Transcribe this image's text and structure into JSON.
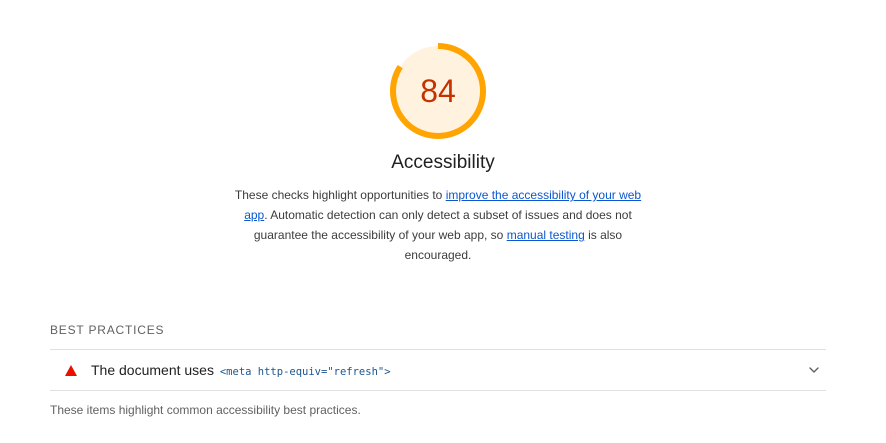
{
  "category": {
    "score": "84",
    "score_fraction": 0.84,
    "title": "Accessibility",
    "description": {
      "part1": "These checks highlight opportunities to ",
      "link1": "improve the accessibility of your web app",
      "part2": ". Automatic detection can only detect a subset of issues and does not guarantee the accessibility of your web app, so ",
      "link2": "manual testing",
      "part3": " is also encouraged."
    },
    "colors": {
      "gauge_arc": "#ffa400",
      "gauge_fill": "#fff3e0",
      "score_text": "#c33300",
      "link": "#0b57d0",
      "fail_icon": "#eb0f00"
    }
  },
  "group": {
    "title": "BEST PRACTICES",
    "description": "These items highlight common accessibility best practices.",
    "audits": [
      {
        "status_icon": "fail-triangle-icon",
        "title_text": "The document uses",
        "title_code": "<meta http-equiv=\"refresh\">",
        "expand_icon": "chevron-down-icon"
      }
    ]
  }
}
